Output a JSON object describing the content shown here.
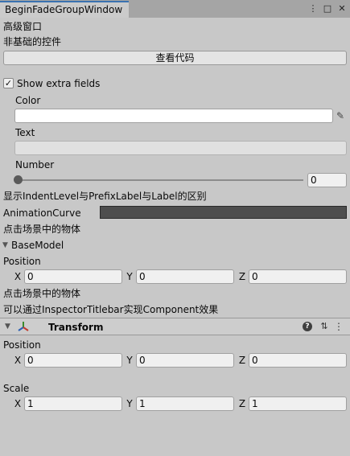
{
  "window": {
    "tab_title": "BeginFadeGroupWindow",
    "menu_icon": "⋮",
    "maximize_icon": "□",
    "close_icon": "✕"
  },
  "headings": {
    "advanced": "高级窗口",
    "nonbasic": "非基础的控件"
  },
  "view_code_button": "查看代码",
  "show_extra": {
    "label": "Show extra fields",
    "checked": true,
    "check_glyph": "✓"
  },
  "color": {
    "label": "Color",
    "value": "#ffffff",
    "picker_icon": "✎"
  },
  "text": {
    "label": "Text",
    "value": ""
  },
  "number": {
    "label": "Number",
    "value": "0",
    "slider_fraction": 0
  },
  "notes": {
    "indent_info": "显示IndentLevel与PrefixLabel与Label的区别",
    "click_object_1": "点击场景中的物体",
    "click_object_2": "点击场景中的物体",
    "titlebar_info": "可以通过InspectorTitlebar实现Component效果"
  },
  "animation_curve": {
    "label": "AnimationCurve",
    "color": "#4e4e4e"
  },
  "base_model": {
    "label": "BaseModel",
    "foldout_icon": "▼",
    "position": {
      "label": "Position",
      "x_label": "X",
      "x": "0",
      "y_label": "Y",
      "y": "0",
      "z_label": "Z",
      "z": "0"
    }
  },
  "transform": {
    "title": "Transform",
    "foldout_icon": "▼",
    "help_icon": "?",
    "preset_icon": "⇅",
    "menu_icon": "⋮",
    "position": {
      "label": "Position",
      "x_label": "X",
      "x": "0",
      "y_label": "Y",
      "y": "0",
      "z_label": "Z",
      "z": "0"
    },
    "scale": {
      "label": "Scale",
      "x_label": "X",
      "x": "1",
      "y_label": "Y",
      "y": "1",
      "z_label": "Z",
      "z": "1"
    }
  }
}
